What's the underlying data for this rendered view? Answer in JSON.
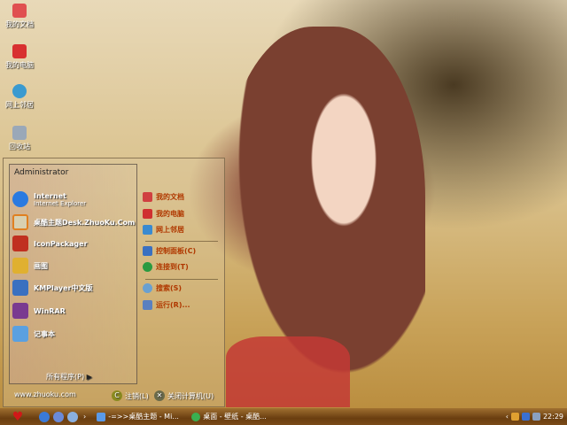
{
  "desktop": {
    "icons": [
      {
        "label": "我的文档"
      },
      {
        "label": "我的电脑"
      },
      {
        "label": "网上邻居"
      },
      {
        "label": "回收站"
      }
    ]
  },
  "start_menu": {
    "user": "Administrator",
    "pinned": [
      {
        "label": "Internet",
        "sub": "Internet Explorer",
        "icon": "ie-icon",
        "color": "#2a7ae0"
      },
      {
        "label": "桌酷主题Desk.ZhuoKu.Com",
        "icon": "theme-icon",
        "color": "#d8d0b0"
      },
      {
        "label": "IconPackager",
        "icon": "iconpackager-icon",
        "color": "#c03020"
      },
      {
        "label": "画图",
        "icon": "paint-icon",
        "color": "#e0b030"
      },
      {
        "label": "KMPlayer中文版",
        "icon": "kmplayer-icon",
        "color": "#3a70c0"
      },
      {
        "label": "WinRAR",
        "icon": "winrar-icon",
        "color": "#7a3a90"
      },
      {
        "label": "记事本",
        "icon": "notepad-icon",
        "color": "#5aa0e0"
      }
    ],
    "all_programs": "所有程序(P)",
    "right": [
      {
        "label": "我的文档",
        "icon": "documents-icon",
        "color": "#d04040"
      },
      {
        "label": "我的电脑",
        "icon": "computer-icon",
        "color": "#d03030"
      },
      {
        "label": "网上邻居",
        "icon": "network-icon",
        "color": "#3a8ad0"
      },
      {
        "label": "控制面板(C)",
        "icon": "control-panel-icon",
        "color": "#3a70c0"
      },
      {
        "label": "连接到(T)",
        "icon": "connect-icon",
        "color": "#2a9a40"
      },
      {
        "label": "搜索(S)",
        "icon": "search-icon",
        "color": "#6aa0d0"
      },
      {
        "label": "运行(R)...",
        "icon": "run-icon",
        "color": "#5a80c0"
      }
    ],
    "website": "www.zhuoku.com",
    "logoff": "注销(L)",
    "shutdown": "关闭计算机(U)"
  },
  "taskbar": {
    "tasks": [
      {
        "label": "-=>>桌酷主题 - Mi..."
      },
      {
        "label": "桌面 - 壁纸 - 桌酷..."
      }
    ],
    "clock": "22:29",
    "accent": "#6a3e10"
  }
}
